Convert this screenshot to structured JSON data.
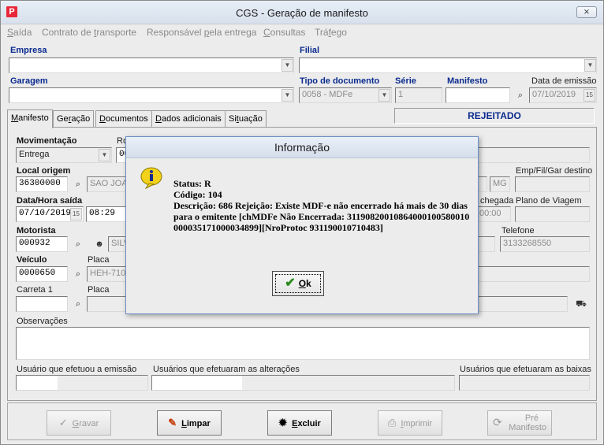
{
  "window": {
    "title": "CGS - Geração de manifesto",
    "app_icon_letter": "P",
    "close_glyph": "⨯"
  },
  "menu": [
    {
      "pre": "",
      "u": "S",
      "post": "aída"
    },
    {
      "pre": "Contrato de ",
      "u": "t",
      "post": "ransporte"
    },
    {
      "pre": "Responsável ",
      "u": "p",
      "post": "ela entrega"
    },
    {
      "pre": "",
      "u": "C",
      "post": "onsultas"
    },
    {
      "pre": "Trá",
      "u": "f",
      "post": "ego"
    }
  ],
  "header": {
    "empresa_label": "Empresa",
    "filial_label": "Filial",
    "garagem_label": "Garagem",
    "tipo_doc_label": "Tipo de documento",
    "tipo_doc_value": "0058 - MDFe",
    "serie_label": "Série",
    "serie_value": "1",
    "manifesto_label": "Manifesto",
    "data_emissao_label": "Data de emissão",
    "data_emissao_value": "07/10/2019",
    "status_value": "REJEITADO"
  },
  "tabs": [
    {
      "u": "M",
      "post": "anifesto",
      "active": true
    },
    {
      "pre": "Ge",
      "u": "r",
      "post": "ação",
      "active": false
    },
    {
      "pre": "",
      "u": "D",
      "post": "ocumentos",
      "active": false
    },
    {
      "pre": "",
      "u": "D",
      "post": "ados adicionais",
      "active": false
    },
    {
      "pre": "Si",
      "u": "t",
      "post": "uação",
      "active": false
    }
  ],
  "form": {
    "movimentacao_label": "Movimentação",
    "movimentacao_value": "Entrega",
    "ro_label": "Ro",
    "ro_value": "00",
    "local_origem_label": "Local origem",
    "local_origem_code": "36300000",
    "local_origem_name": "SAO JOAO",
    "uf_value": "MG",
    "emp_fil_gar_label": "Emp/Fil/Gar destino",
    "data_hora_label": "Data/Hora saída",
    "data_saida": "07/10/2019",
    "hora_saida": "08:29",
    "chegada_label": "chegada",
    "chegada_value": "00:00",
    "plano_viagem_label": "Plano de Viagem",
    "motorista_label": "Motorista",
    "motorista_code": "000932",
    "motorista_name": "SILV",
    "telefone_label": "Telefone",
    "telefone_value": "3133268550",
    "veiculo_label": "Veículo",
    "veiculo_code": "0000650",
    "placa_label": "Placa",
    "placa_value": "HEH-7106",
    "carreta_label": "Carreta 1",
    "carreta_placa_label": "Placa",
    "observacoes_label": "Observações",
    "usuario_emissao_label": "Usuário que efetuou a emissão",
    "usuarios_alteracoes_label": "Usuários que efetuaram as alterações",
    "usuarios_baixas_label": "Usuários que efetuaram as baixas"
  },
  "buttons": {
    "gravar": {
      "u": "G",
      "post": "ravar"
    },
    "limpar": {
      "u": "L",
      "post": "impar"
    },
    "excluir": {
      "u": "E",
      "post": "xcluir"
    },
    "imprimir": {
      "u": "I",
      "post": "mprimir"
    },
    "pre_manifesto_line1": "Pré",
    "pre_manifesto_line2": "Manifesto"
  },
  "dialog": {
    "title": "Informação",
    "status_line": "Status: R",
    "codigo_line": "Código: 104",
    "descricao_line": "Descrição: 686 Rejeição: Existe MDF-e não encerrado há mais de 30 dias para o emitente [chMDFe Não Encerrada: 31190820010864000100580010000035171000034899][NroProtoc 931190010710483]",
    "ok": {
      "u": "O",
      "post": "k"
    }
  },
  "colors": {
    "accent_blue": "#0a2a8e",
    "app_icon_red": "#e8273a",
    "ok_check_green": "#2a8a1e",
    "info_icon_yellow": "#f2d21b"
  }
}
